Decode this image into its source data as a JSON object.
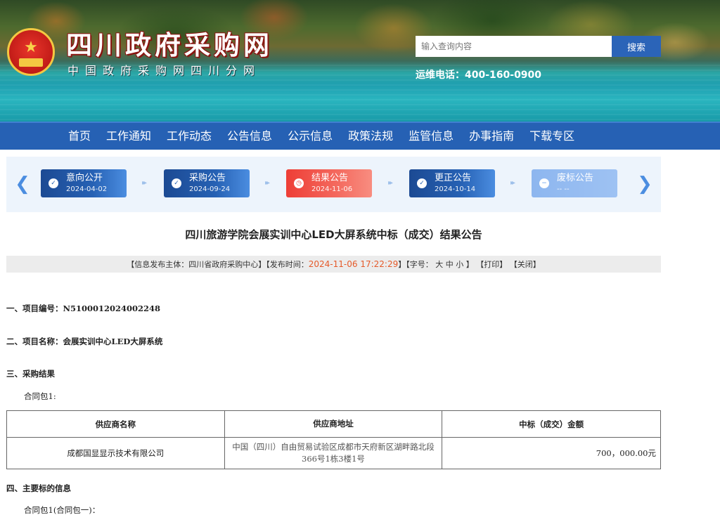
{
  "header": {
    "site_title": "四川政府采购网",
    "site_subtitle": "中国政府采购网四川分网",
    "search": {
      "placeholder": "输入查询内容",
      "button_label": "搜索"
    },
    "hotline": "运维电话：400-160-0900"
  },
  "nav": {
    "items": [
      {
        "label": "首页"
      },
      {
        "label": "工作通知"
      },
      {
        "label": "工作动态"
      },
      {
        "label": "公告信息"
      },
      {
        "label": "公示信息"
      },
      {
        "label": "政策法规"
      },
      {
        "label": "监管信息"
      },
      {
        "label": "办事指南"
      },
      {
        "label": "下载专区"
      }
    ]
  },
  "timeline": {
    "steps": [
      {
        "label": "意向公开",
        "date": "2024-04-02",
        "state": "done"
      },
      {
        "label": "采购公告",
        "date": "2024-09-24",
        "state": "done"
      },
      {
        "label": "结果公告",
        "date": "2024-11-06",
        "state": "current"
      },
      {
        "label": "更正公告",
        "date": "2024-10-14",
        "state": "done"
      },
      {
        "label": "废标公告",
        "date": "-- --",
        "state": "none"
      }
    ],
    "colors": {
      "done": "#2661b4",
      "current": "#ee3e36",
      "none": "#8db6ef"
    }
  },
  "article": {
    "title": "四川旅游学院会展实训中心LED大屏系统中标（成交）结果公告",
    "meta": {
      "publisher": "【信息发布主体：四川省政府采购中心】",
      "time_label": "【发布时间：",
      "time": "2024-11-06 17:22:29",
      "time_close": "】",
      "font_size_label": "【字号：",
      "font_large": "大",
      "font_medium": "中",
      "font_small": "小",
      "font_close": "】",
      "print": "【打印】",
      "close": "【关闭】"
    },
    "project_number": "一、项目编号：N5100012024002248",
    "project_name": "二、项目名称：会展实训中心LED大屏系统",
    "result_heading": "三、采购结果",
    "package_1": "合同包1:",
    "table": {
      "headers": [
        "供应商名称",
        "供应商地址",
        "中标（成交）金额"
      ],
      "rows": [
        {
          "name": "成都国显显示技术有限公司",
          "address": "中国（四川）自由贸易试验区成都市天府新区湖畔路北段366号1栋3楼1号",
          "amount": "700，000.00元"
        }
      ]
    },
    "main_info_heading": "四、主要标的信息",
    "package_1_full": "合同包1(合同包一)："
  },
  "colors": {
    "nav_bg": "#2661b4",
    "search_button": "#2b64b8",
    "timeline_bg": "#edf4fc",
    "publish_time": "#e55a2a"
  }
}
